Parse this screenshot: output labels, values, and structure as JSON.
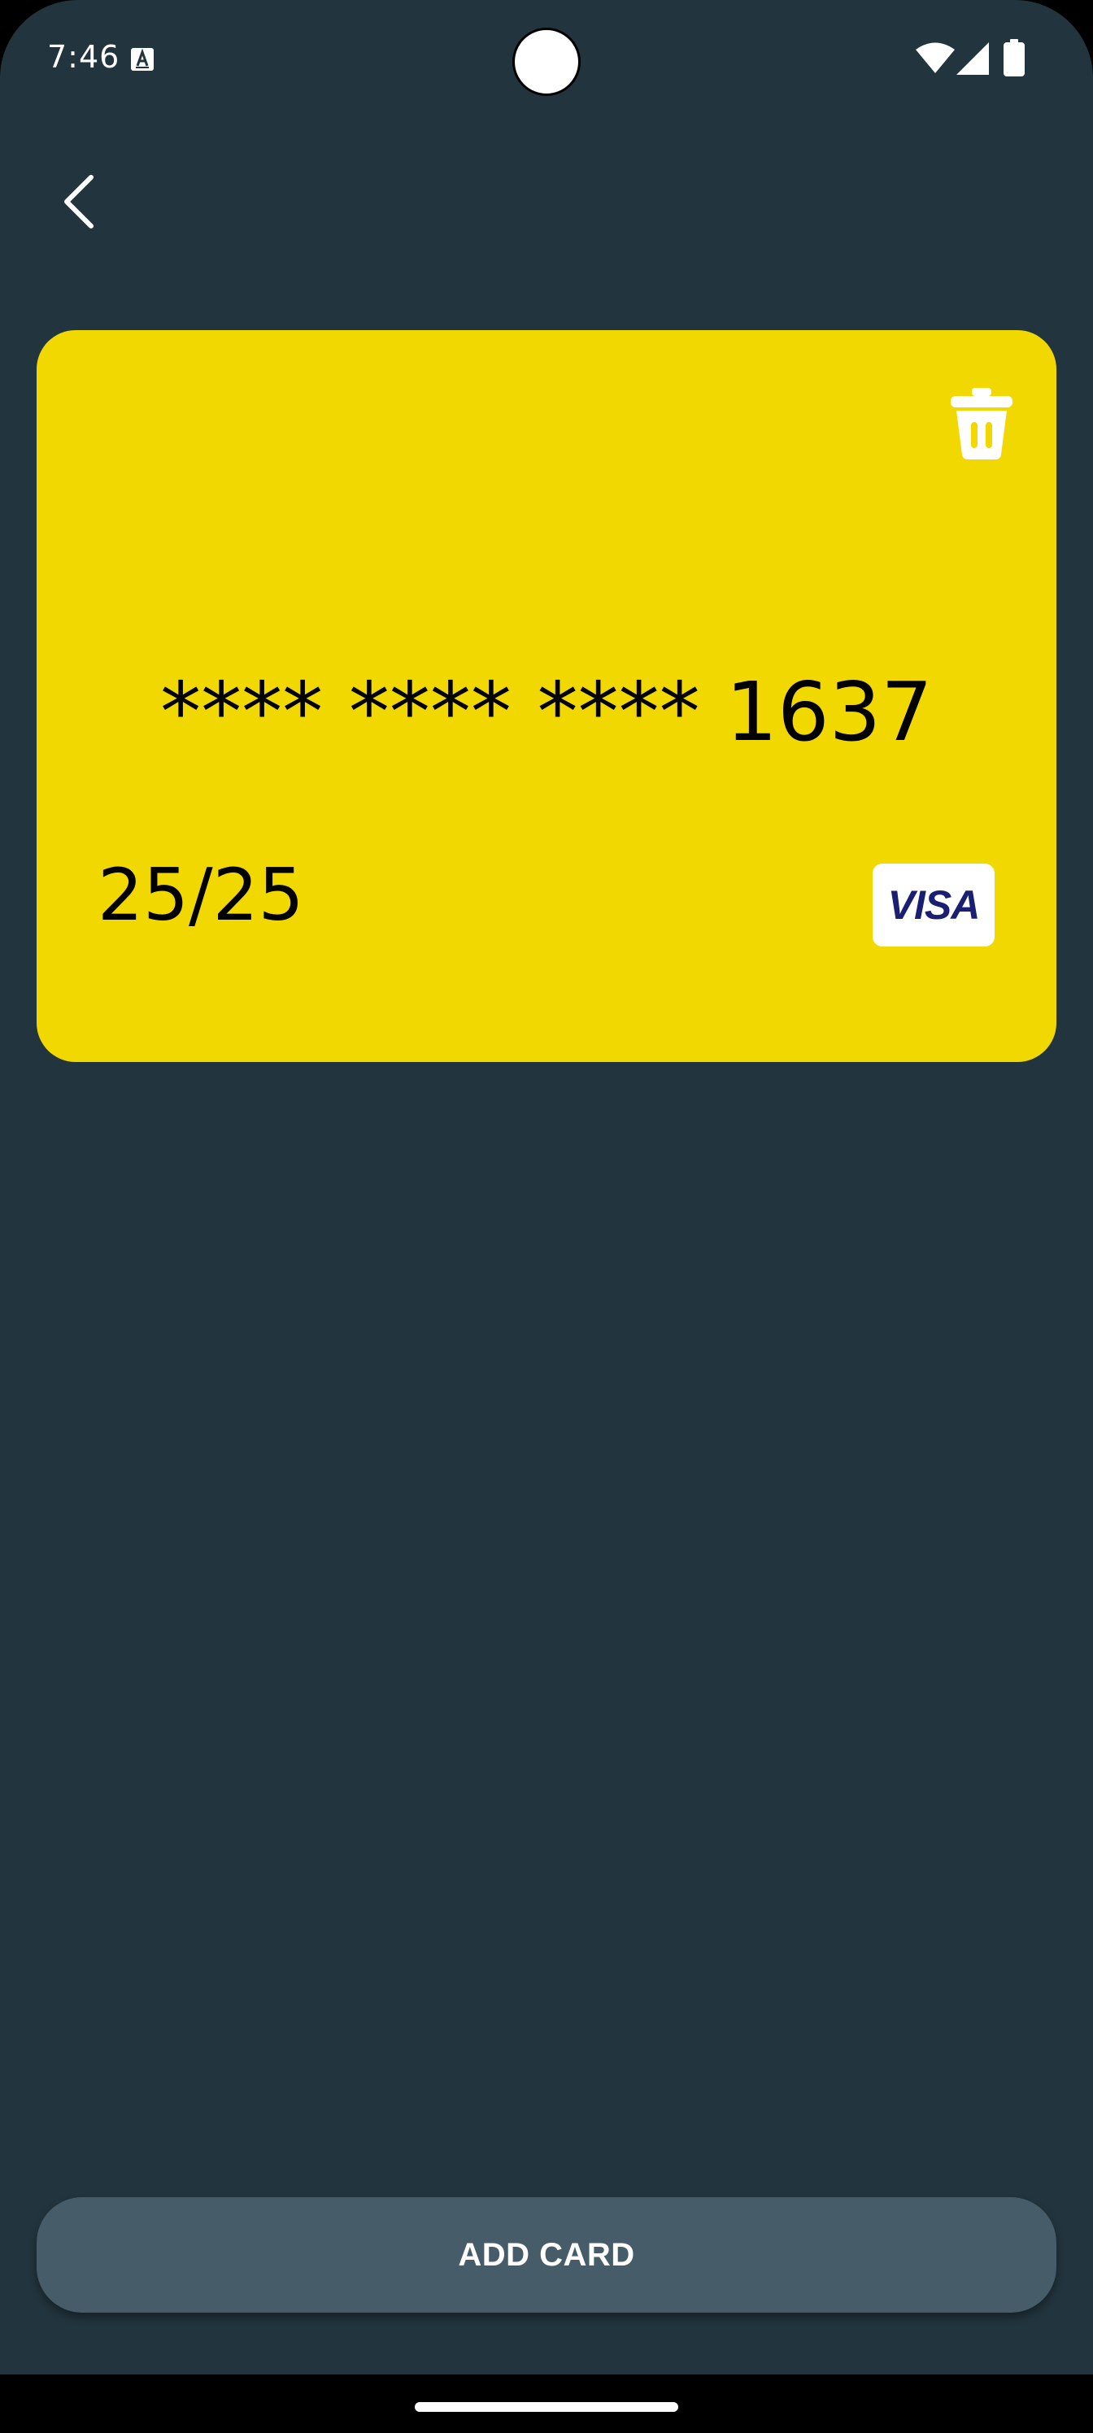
{
  "status_bar": {
    "time": "7:46",
    "icons": [
      "keyboard-a-icon",
      "wifi-icon",
      "signal-icon",
      "battery-icon"
    ]
  },
  "header": {
    "back_icon": "chevron-left-icon"
  },
  "card": {
    "number": "**** **** **** 1637",
    "expiry": "25/25",
    "brand": "VISA",
    "delete_icon": "trash-icon",
    "color": "#f0d800"
  },
  "actions": {
    "add_card_label": "ADD CARD"
  },
  "colors": {
    "background": "#22343d",
    "button": "#465d69",
    "visa_blue": "#1a1f71"
  }
}
